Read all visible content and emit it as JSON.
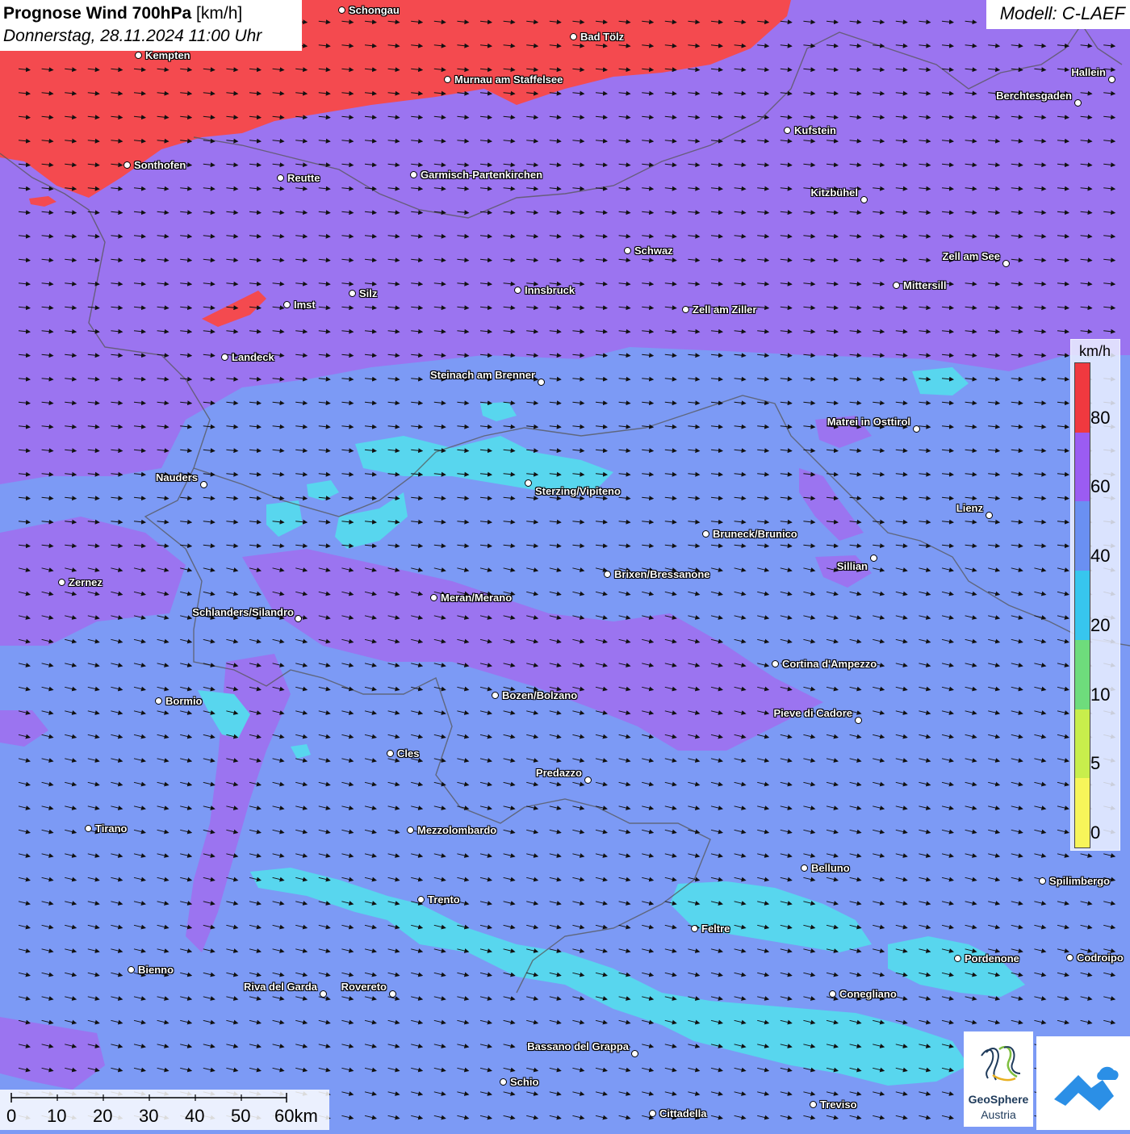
{
  "header": {
    "title_bold": "Prognose Wind 700hPa",
    "title_unit": "[km/h]",
    "datetime": "Donnerstag, 28.11.2024 11:00 Uhr",
    "model": "Modell: C-LAEF"
  },
  "colors": {
    "red": "#f44a4f",
    "purple": "#9b74f0",
    "blue": "#7c9af5",
    "cyan": "#58d6ee",
    "arrow": "#111111",
    "border": "#555555"
  },
  "legend": {
    "unit": "km/h",
    "labels": [
      "80",
      "60",
      "40",
      "20",
      "10",
      "5",
      "0"
    ],
    "segment_colors": [
      "#f0393f",
      "#9b5cf2",
      "#6a90f2",
      "#37c6ee",
      "#6edc7c",
      "#c8ee4c",
      "#f7f55a"
    ]
  },
  "scalebar": {
    "labels": [
      "0",
      "10",
      "20",
      "30",
      "40",
      "50",
      "60km"
    ]
  },
  "cities": [
    {
      "name": "Schongau"
    },
    {
      "name": "Bad Tölz"
    },
    {
      "name": "Kempten"
    },
    {
      "name": "Murnau am Staffelsee"
    },
    {
      "name": "Hallein"
    },
    {
      "name": "Berchtesgaden"
    },
    {
      "name": "Kufstein"
    },
    {
      "name": "Sonthofen"
    },
    {
      "name": "Reutte"
    },
    {
      "name": "Garmisch-Partenkirchen"
    },
    {
      "name": "Kitzbühel"
    },
    {
      "name": "Schwaz"
    },
    {
      "name": "Zell am See"
    },
    {
      "name": "Mittersill"
    },
    {
      "name": "Silz"
    },
    {
      "name": "Innsbruck"
    },
    {
      "name": "Imst"
    },
    {
      "name": "Zell am Ziller"
    },
    {
      "name": "Landeck"
    },
    {
      "name": "Steinach am Brenner"
    },
    {
      "name": "Matrei in Osttirol"
    },
    {
      "name": "Nauders"
    },
    {
      "name": "Sterzing/Vipiteno"
    },
    {
      "name": "Lienz"
    },
    {
      "name": "Bruneck/Brunico"
    },
    {
      "name": "Sillian"
    },
    {
      "name": "Zernez"
    },
    {
      "name": "Brixen/Bressanone"
    },
    {
      "name": "Meran/Merano"
    },
    {
      "name": "Schlanders/Silandro"
    },
    {
      "name": "Cortina d'Ampezzo"
    },
    {
      "name": "Bozen/Bolzano"
    },
    {
      "name": "Bormio"
    },
    {
      "name": "Pieve di Cadore"
    },
    {
      "name": "Cles"
    },
    {
      "name": "Predazzo"
    },
    {
      "name": "Tirano"
    },
    {
      "name": "Mezzolombardo"
    },
    {
      "name": "Belluno"
    },
    {
      "name": "Spilimbergo"
    },
    {
      "name": "Trento"
    },
    {
      "name": "Feltre"
    },
    {
      "name": "Pordenone"
    },
    {
      "name": "Codroipo"
    },
    {
      "name": "Bienno"
    },
    {
      "name": "Riva del Garda"
    },
    {
      "name": "Rovereto"
    },
    {
      "name": "Conegliano"
    },
    {
      "name": "Bassano del Grappa"
    },
    {
      "name": "Schio"
    },
    {
      "name": "Treviso"
    },
    {
      "name": "Cittadella"
    }
  ],
  "logos": {
    "geosphere_line1": "GeoSphere",
    "geosphere_line2": "Austria"
  }
}
